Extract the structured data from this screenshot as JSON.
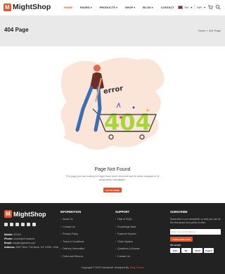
{
  "header": {
    "logo_text": "MightShop",
    "logo_letter": "M",
    "nav": [
      {
        "label": "HOME",
        "active": true,
        "caret": false
      },
      {
        "label": "PAGES",
        "active": false,
        "caret": true
      },
      {
        "label": "PRODUCTS",
        "active": false,
        "caret": true
      },
      {
        "label": "SHOP",
        "active": false,
        "caret": true
      },
      {
        "label": "BLOG",
        "active": false,
        "caret": true
      },
      {
        "label": "CONTACT",
        "active": false,
        "caret": false
      }
    ],
    "language": "EN",
    "currency": "INR"
  },
  "banner": {
    "title": "404 Page",
    "breadcrumb": "Home  »  404 Page"
  },
  "error": {
    "word": "error",
    "code": "404",
    "title": "Page Not Found",
    "text": "The page you are looking for might have been removed had its name changed or is temporarily unavailable.",
    "button": "GO TO HOME"
  },
  "footer": {
    "logo_text": "MightShop",
    "contact": {
      "mobile_label": "Mobile:",
      "mobile_value": "67418",
      "phone_label": "Phone:",
      "phone_value": "coustnpc5 dustun4",
      "email_label": "Email:",
      "email_value": "info@mightweb.com",
      "address_label": "Address:",
      "address_value": "8957 Blvd. The Bunk, NY 10001, USA"
    },
    "information": {
      "heading": "INFORMATION",
      "items": [
        "About Us",
        "Contact Us",
        "Privacy Policy",
        "Terms & Conditions",
        "Delivery Information",
        "Order and Returns"
      ]
    },
    "support": {
      "heading": "SUPPORT",
      "items": [
        "Help & FAQs",
        "Knowledge Base",
        "Payment System",
        "Order System",
        "Questions & Answer",
        "Contact Us"
      ]
    },
    "subscribe": {
      "heading": "SUBSCRIBE",
      "text": "Subscribe to our newsletter so that you can be the first about new prints of offer.",
      "placeholder": "Enter Your Email Address",
      "button": "SUBSCRIBE NOW",
      "we_accept": "We accept",
      "payments": [
        "VISA",
        "MC",
        "Skrill",
        "PayPal"
      ]
    },
    "copyright_pre": "Copyright © 2020 Handicraft. Designed By ",
    "copyright_brand": "Tiling Theme"
  },
  "colors": {
    "accent": "#f04e23",
    "footer_bg": "#222222",
    "banner_bg": "#e9e9e9"
  }
}
